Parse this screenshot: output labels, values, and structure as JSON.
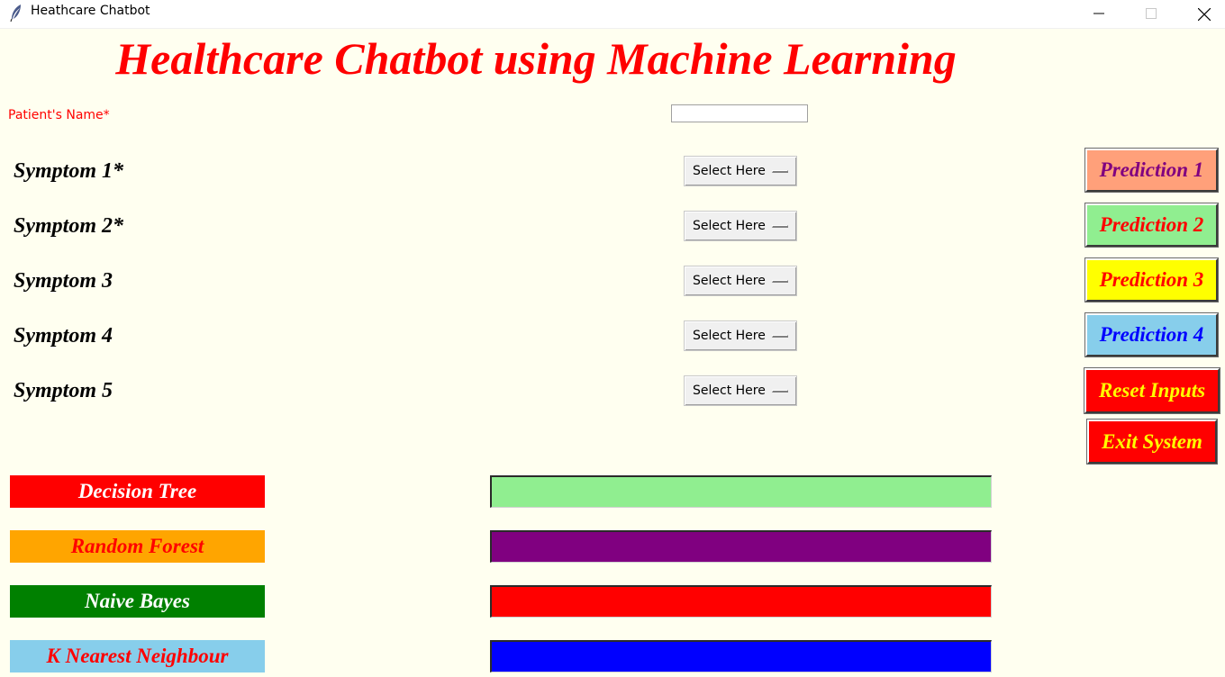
{
  "window": {
    "title": "Heathcare Chatbot",
    "icon": "feather-icon"
  },
  "heading": "Healthcare Chatbot using Machine Learning",
  "patient": {
    "label": "Patient's Name*",
    "value": ""
  },
  "symptoms": [
    {
      "label": "Symptom 1*",
      "selected": "Select Here"
    },
    {
      "label": "Symptom 2*",
      "selected": "Select Here"
    },
    {
      "label": "Symptom 3",
      "selected": "Select Here"
    },
    {
      "label": "Symptom 4",
      "selected": "Select Here"
    },
    {
      "label": "Symptom 5",
      "selected": "Select Here"
    }
  ],
  "buttons": [
    {
      "label": "Prediction 1",
      "bg": "#ffa07a",
      "fg": "#800080"
    },
    {
      "label": "Prediction 2",
      "bg": "#90ee90",
      "fg": "#ff0000"
    },
    {
      "label": "Prediction 3",
      "bg": "#ffff00",
      "fg": "#ff0000"
    },
    {
      "label": "Prediction 4",
      "bg": "#87ceeb",
      "fg": "#0000ff"
    },
    {
      "label": "Reset Inputs",
      "bg": "#ff0000",
      "fg": "#ffff00"
    },
    {
      "label": "Exit System",
      "bg": "#ff0000",
      "fg": "#ffff00"
    }
  ],
  "algorithms": [
    {
      "label": "Decision Tree",
      "bg": "#ff0000",
      "fg": "#ffffff",
      "result_bg": "#90ee90",
      "result": ""
    },
    {
      "label": "Random Forest",
      "bg": "#ffa500",
      "fg": "#ff0000",
      "result_bg": "#800080",
      "result": ""
    },
    {
      "label": "Naive Bayes",
      "bg": "#008000",
      "fg": "#ffffff",
      "result_bg": "#ff0000",
      "result": ""
    },
    {
      "label": "K Nearest Neighbour",
      "bg": "#87ceeb",
      "fg": "#ff0000",
      "result_bg": "#0000ff",
      "result": ""
    }
  ]
}
